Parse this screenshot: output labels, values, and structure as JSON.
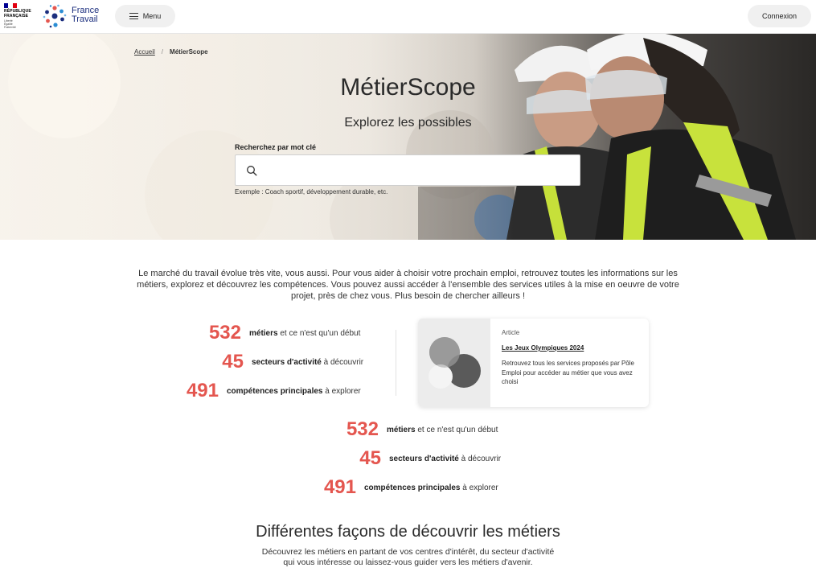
{
  "header": {
    "republique_line1": "RÉPUBLIQUE",
    "republique_line2": "FRANÇAISE",
    "motto": [
      "Liberté",
      "Égalité",
      "Fraternité"
    ],
    "brand_line1": "France",
    "brand_line2": "Travail",
    "menu_label": "Menu",
    "login_label": "Connexion"
  },
  "breadcrumb": {
    "home": "Accueil",
    "separator": "/",
    "current": "MétierScope"
  },
  "hero": {
    "title": "MétierScope",
    "subtitle": "Explorez les possibles",
    "search_label": "Recherchez par mot clé",
    "search_value": "",
    "search_hint": "Exemple : Coach sportif, développement durable, etc."
  },
  "intro": "Le marché du travail évolue très vite, vous aussi. Pour vous aider à choisir votre prochain emploi, retrouvez toutes les informations sur les métiers, explorez et découvrez les compétences. Vous pouvez aussi accéder à l'ensemble des services utiles à la mise en oeuvre de votre projet, près de chez vous. Plus besoin de chercher ailleurs !",
  "stats_primary": [
    {
      "number": "532",
      "bold": "métiers",
      "rest": " et ce n'est qu'un début"
    },
    {
      "number": "45",
      "bold": "secteurs d'activité",
      "rest": " à découvrir"
    },
    {
      "number": "491",
      "bold": "compétences principales",
      "rest": " à explorer"
    }
  ],
  "stats_secondary": [
    {
      "number": "532",
      "bold": "métiers",
      "rest": " et ce n'est qu'un début"
    },
    {
      "number": "45",
      "bold": "secteurs d'activité",
      "rest": " à découvrir"
    },
    {
      "number": "491",
      "bold": "compétences principales",
      "rest": " à explorer"
    }
  ],
  "article": {
    "tag": "Article",
    "title": "Les Jeux Olympiques 2024",
    "description": "Retrouvez tous les services proposés par Pôle Emploi pour accéder au métier que vous avez choisi"
  },
  "section": {
    "title": "Différentes façons de découvrir les métiers",
    "subtitle_line1": "Découvrez les métiers en partant de vos centres d'intérêt, du secteur d'activité",
    "subtitle_line2": "qui vous intéresse ou laissez-vous guider vers les métiers d'avenir."
  },
  "colors": {
    "accent_red": "#e4564f",
    "brand_blue": "#1b2e7e"
  }
}
